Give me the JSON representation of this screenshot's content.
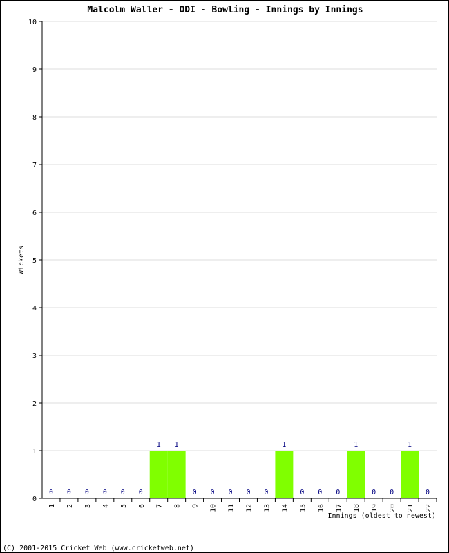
{
  "chart_data": {
    "type": "bar",
    "title": "Malcolm Waller - ODI - Bowling - Innings by Innings",
    "xlabel": "Innings (oldest to newest)",
    "ylabel": "Wickets",
    "ylim": [
      0,
      10
    ],
    "yticks": [
      "0",
      "1",
      "2",
      "3",
      "4",
      "5",
      "6",
      "7",
      "8",
      "9",
      "10"
    ],
    "grid": true,
    "categories": [
      "1",
      "2",
      "3",
      "4",
      "5",
      "6",
      "7",
      "8",
      "9",
      "10",
      "11",
      "12",
      "13",
      "14",
      "15",
      "16",
      "17",
      "18",
      "19",
      "20",
      "21",
      "22"
    ],
    "values": [
      0,
      0,
      0,
      0,
      0,
      0,
      1,
      1,
      0,
      0,
      0,
      0,
      0,
      1,
      0,
      0,
      0,
      1,
      0,
      0,
      1,
      0
    ],
    "bar_color": "#80ff00",
    "label_color": "#000080"
  },
  "footer": "(C) 2001-2015 Cricket Web (www.cricketweb.net)"
}
